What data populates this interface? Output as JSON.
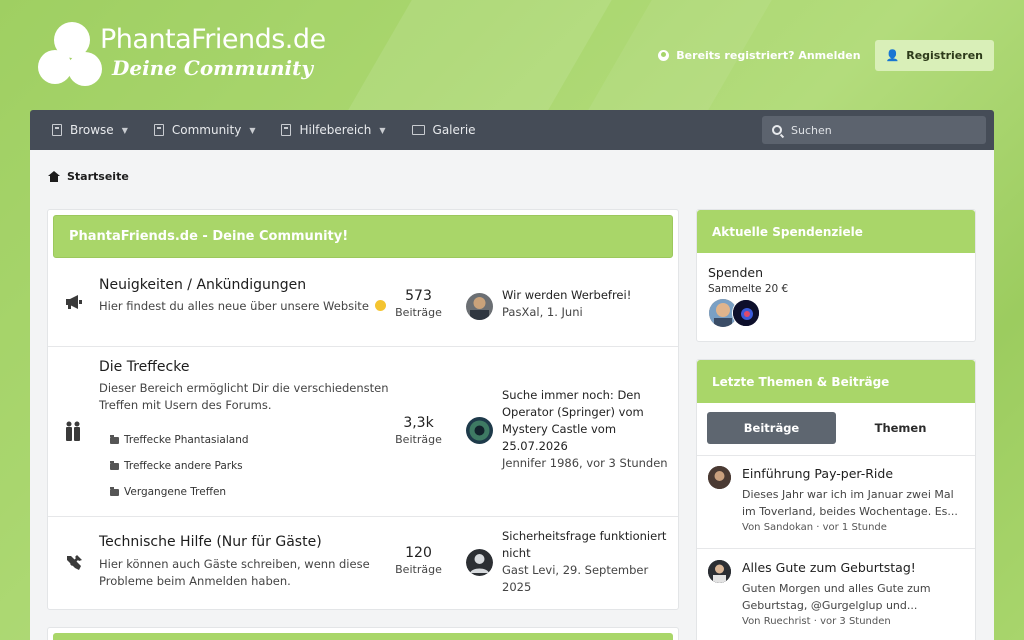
{
  "site": {
    "logo_title": "PhantaFriends.de",
    "logo_subtitle": "Deine Community"
  },
  "header": {
    "login_label": "Bereits registriert? Anmelden",
    "register_label": "Registrieren"
  },
  "nav": {
    "items": [
      {
        "label": "Browse"
      },
      {
        "label": "Community"
      },
      {
        "label": "Hilfebereich"
      },
      {
        "label": "Galerie"
      }
    ],
    "search_placeholder": "Suchen"
  },
  "breadcrumb": {
    "label": "Startseite"
  },
  "forum": {
    "title": "PhantaFriends.de - Deine Community!",
    "nodes": [
      {
        "title": "Neuigkeiten / Ankündigungen",
        "desc": "Hier findest du alles neue über unsere Website",
        "count": "573",
        "count_label": "Beiträge",
        "last_title": "Wir werden Werbefrei!",
        "last_meta": "PasXal, 1. Juni"
      },
      {
        "title": "Die Treffecke",
        "desc": "Dieser Bereich ermöglicht Dir die verschiedensten Treffen mit Usern des Forums.",
        "subforums": [
          "Treffecke Phantasialand",
          "Treffecke andere Parks",
          "Vergangene Treffen"
        ],
        "count": "3,3k",
        "count_label": "Beiträge",
        "last_title": "Suche immer noch: Den Operator (Springer) vom Mystery Castle vom 25.07.2026",
        "last_meta": "Jennifer 1986, vor 3 Stunden"
      },
      {
        "title": "Technische Hilfe (Nur für Gäste)",
        "desc": "Hier können auch Gäste schreiben, wenn diese Probleme beim Anmelden haben.",
        "count": "120",
        "count_label": "Beiträge",
        "last_title": "Sicherheitsfrage funktioniert nicht",
        "last_meta": "Gast Levi, 29. September 2025"
      }
    ]
  },
  "donations": {
    "title": "Aktuelle Spendenziele",
    "label": "Spenden",
    "amount": "Sammelte 20 €"
  },
  "latest": {
    "title": "Letzte Themen & Beiträge",
    "tabs": [
      "Beiträge",
      "Themen"
    ],
    "posts": [
      {
        "title": "Einführung Pay-per-Ride",
        "snippet": "Dieses Jahr war ich im Januar zwei Mal im Toverland, beides Wochentage. Es...",
        "meta": "Von Sandokan · vor 1 Stunde"
      },
      {
        "title": "Alles Gute zum Geburtstag!",
        "snippet": "Guten Morgen und alles Gute zum Geburtstag, @Gurgelglup und...",
        "meta": "Von Ruechrist · vor 3 Stunden"
      }
    ]
  },
  "colors": {
    "accent_green": "#a9d669",
    "nav_bg": "#454c57",
    "tab_active": "#5e6670"
  }
}
